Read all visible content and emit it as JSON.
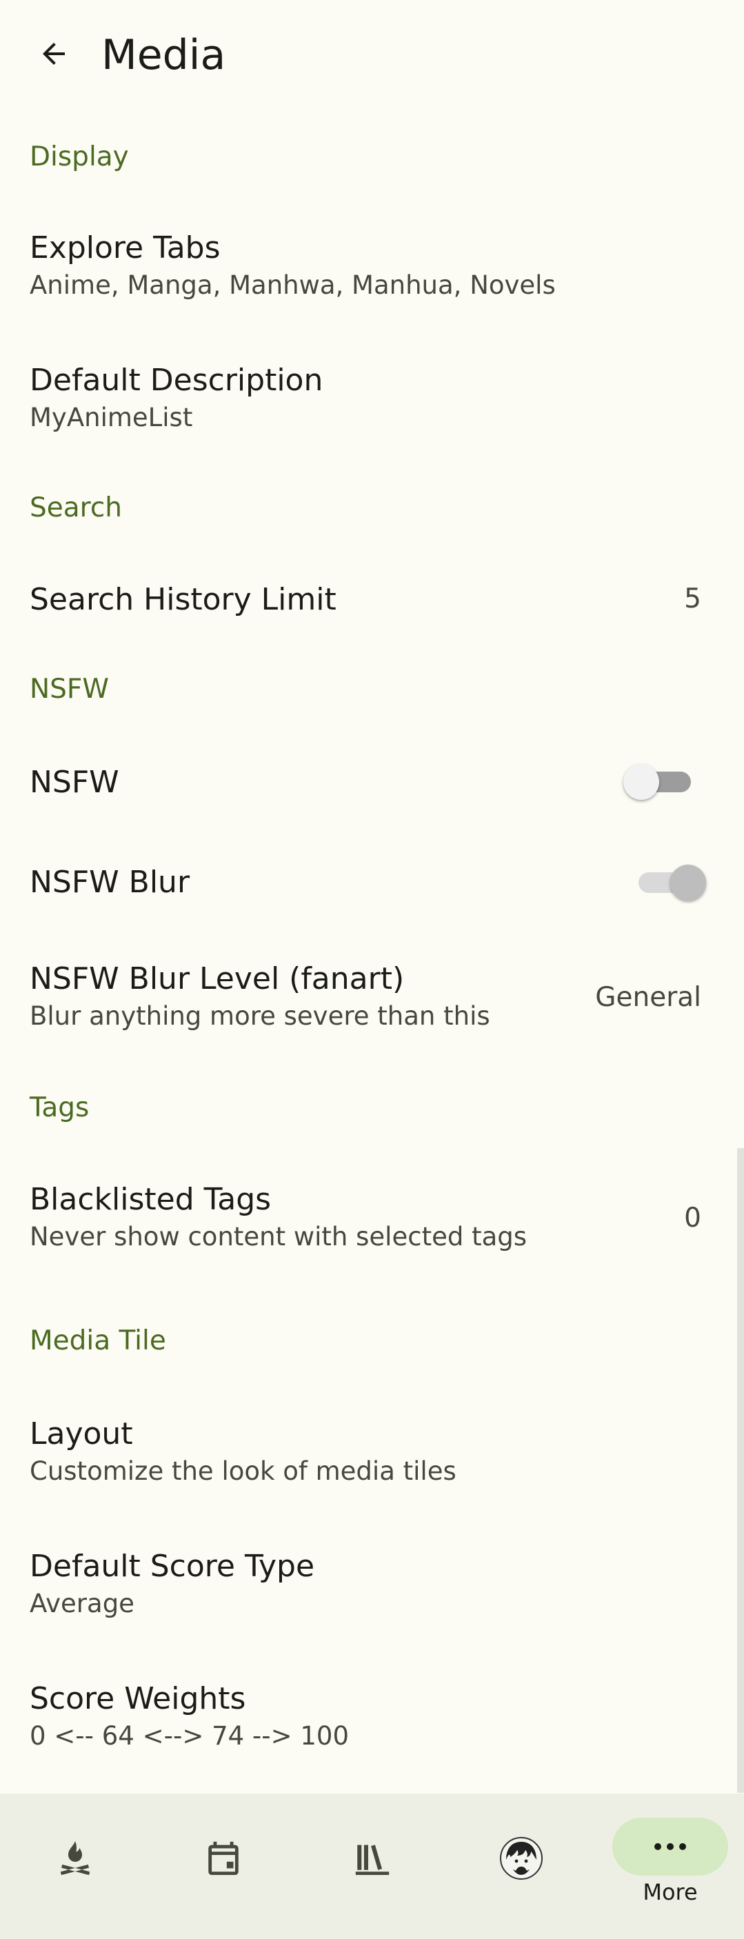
{
  "appbar": {
    "title": "Media"
  },
  "sections": {
    "display": "Display",
    "search": "Search",
    "nsfw": "NSFW",
    "tags": "Tags",
    "media_tile": "Media Tile"
  },
  "prefs": {
    "explore_tabs": {
      "title": "Explore Tabs",
      "summary": "Anime, Manga, Manhwa, Manhua, Novels"
    },
    "default_description": {
      "title": "Default Description",
      "summary": "MyAnimeList"
    },
    "search_history_limit": {
      "title": "Search History Limit",
      "value": "5"
    },
    "nsfw": {
      "title": "NSFW",
      "enabled": false
    },
    "nsfw_blur": {
      "title": "NSFW Blur",
      "enabled": true
    },
    "nsfw_blur_level": {
      "title": "NSFW Blur Level (fanart)",
      "summary": "Blur anything more severe than this",
      "value": "General"
    },
    "blacklisted_tags": {
      "title": "Blacklisted Tags",
      "summary": "Never show content with selected tags",
      "value": "0"
    },
    "layout": {
      "title": "Layout",
      "summary": "Customize the look of media tiles"
    },
    "default_score_type": {
      "title": "Default Score Type",
      "summary": "Average"
    },
    "score_weights": {
      "title": "Score Weights",
      "summary": "0 <-- 64 <--> 74 --> 100"
    }
  },
  "bottom_nav": {
    "items": [
      {
        "icon": "campfire-icon"
      },
      {
        "icon": "calendar-icon"
      },
      {
        "icon": "library-icon"
      },
      {
        "icon": "avatar"
      },
      {
        "icon": "more-horizontal-icon",
        "label": "More",
        "selected": true
      }
    ]
  },
  "colors": {
    "background": "#fcfcf4",
    "section_header": "#4c6a22",
    "nav_background": "#eeefe4",
    "nav_selected_pill": "#d5e9c2"
  }
}
